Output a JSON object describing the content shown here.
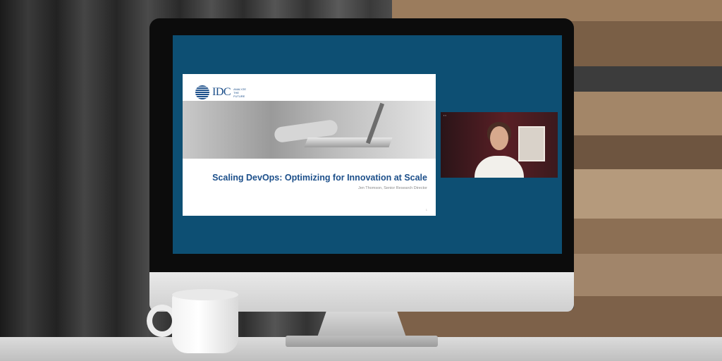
{
  "slide": {
    "logo_text": "IDC",
    "logo_tagline": "ANALYZE THE FUTURE",
    "title": "Scaling DevOps: Optimizing for Innovation at Scale",
    "presenter": "Jen Thomson, Senior Research Director",
    "page_number": "1"
  },
  "video": {
    "controls_label": "▪ ▪"
  },
  "colors": {
    "screen_background": "#0d4f73",
    "brand_blue": "#1c4f8a"
  },
  "icons": {
    "logo_mark": "globe-icon"
  }
}
